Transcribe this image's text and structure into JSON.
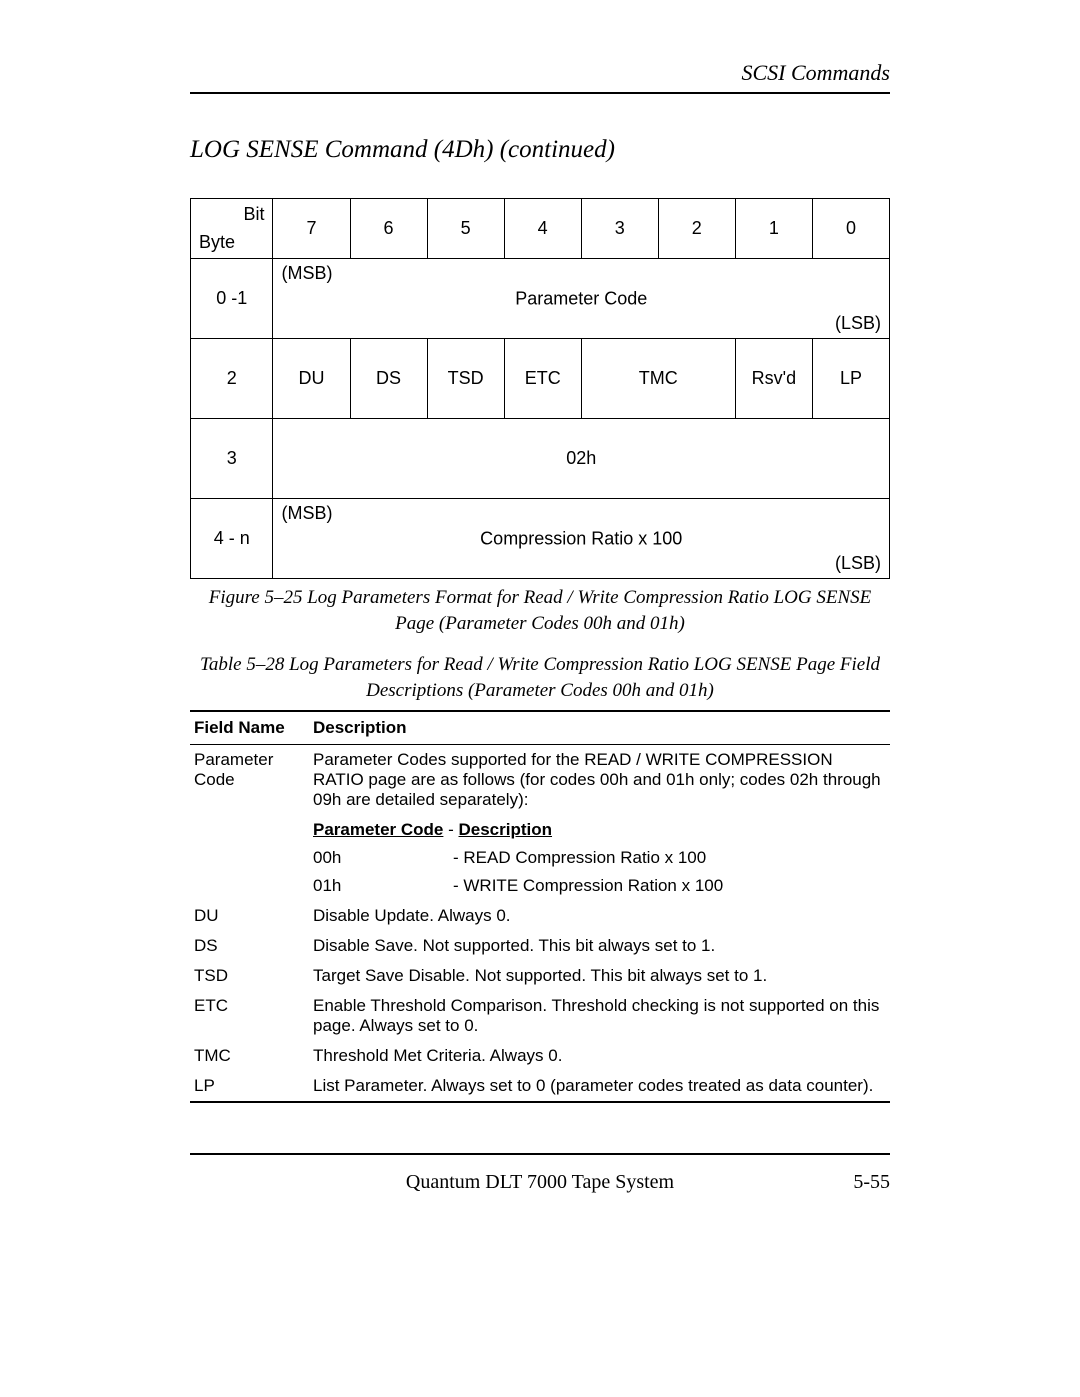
{
  "header": {
    "section_title": "SCSI Commands"
  },
  "page_title": "LOG SENSE Command  (4Dh)   (continued)",
  "figure_table": {
    "bit_label": "Bit",
    "byte_label": "Byte",
    "bits": [
      "7",
      "6",
      "5",
      "4",
      "3",
      "2",
      "1",
      "0"
    ],
    "rows": [
      {
        "byte": "0 -1",
        "msb": "(MSB)",
        "content": "Parameter Code",
        "lsb": "(LSB)",
        "span": 8
      },
      {
        "byte": "2",
        "cells": [
          "DU",
          "DS",
          "TSD",
          "ETC",
          "TMC",
          "Rsv'd",
          "LP"
        ],
        "tmc_span": 2
      },
      {
        "byte": "3",
        "content": "02h",
        "span": 8
      },
      {
        "byte": "4 - n",
        "msb": "(MSB)",
        "content": "Compression Ratio x 100",
        "lsb": "(LSB)",
        "span": 8
      }
    ]
  },
  "figure_caption_line1": "Figure 5–25  Log Parameters Format for Read / Write Compression Ratio LOG SENSE",
  "figure_caption_line2": "Page (Parameter Codes 00h and 01h)",
  "table_caption_line1": "Table 5–28  Log Parameters for Read / Write Compression Ratio LOG SENSE Page Field",
  "table_caption_line2": "Descriptions (Parameter Codes 00h and 01h)",
  "desc_table": {
    "headers": {
      "field": "Field Name",
      "desc": "Description"
    },
    "param_code": {
      "field": "Parameter Code",
      "intro": "Parameter Codes supported for the READ / WRITE COMPRESSION RATIO page are as follows (for codes 00h and 01h only; codes 02h through 09h are detailed separately):",
      "sub_header_code": "Parameter Code",
      "sub_header_sep": " - ",
      "sub_header_desc": "Description",
      "items": [
        {
          "code": "00h",
          "desc": "- READ Compression Ratio x 100"
        },
        {
          "code": "01h",
          "desc": "- WRITE Compression Ration x 100"
        }
      ]
    },
    "rows": [
      {
        "field": "DU",
        "desc": "Disable Update. Always 0."
      },
      {
        "field": "DS",
        "desc": "Disable Save. Not supported. This bit always set to 1."
      },
      {
        "field": "TSD",
        "desc": "Target Save Disable. Not supported. This bit always set to 1."
      },
      {
        "field": "ETC",
        "desc": "Enable Threshold Comparison. Threshold checking is not supported on this page. Always set to 0."
      },
      {
        "field": "TMC",
        "desc": "Threshold Met Criteria. Always 0."
      },
      {
        "field": "LP",
        "desc": "List Parameter. Always set to 0 (parameter codes treated as data counter)."
      }
    ]
  },
  "footer": {
    "center": "Quantum DLT 7000 Tape System",
    "right": "5-55"
  }
}
